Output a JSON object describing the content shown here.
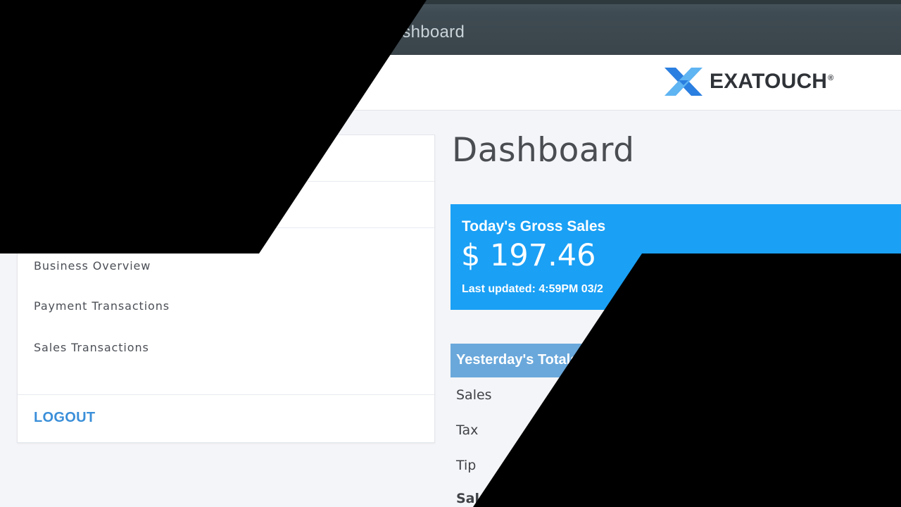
{
  "window": {
    "title": "Dashboard"
  },
  "header": {
    "logo_text": "EXATOUCH",
    "logo_reg": "®"
  },
  "sidebar": {
    "items": [
      {
        "label": "Business Overview"
      },
      {
        "label": "Payment Transactions"
      },
      {
        "label": "Sales Transactions"
      }
    ],
    "logout_label": "LOGOUT"
  },
  "main": {
    "title": "Dashboard",
    "gross_sales": {
      "label": "Today's Gross Sales",
      "amount": "$ 197.46",
      "updated": "Last updated: 4:59PM 03/2"
    },
    "yesterday": {
      "header": "Yesterday's Totals",
      "rows": [
        "Sales",
        "Tax",
        "Tip",
        "Sal"
      ]
    }
  },
  "colors": {
    "accent_blue": "#1aa0f5",
    "totals_header_blue": "#6aa8db",
    "logout_blue": "#3b8fd9",
    "titlebar": "#3f4b52",
    "logo_x_blue": "#2b7fe0",
    "logo_x_light": "#5fb4f2"
  },
  "icons": {
    "logo": "exatouch-x-logo-icon"
  }
}
